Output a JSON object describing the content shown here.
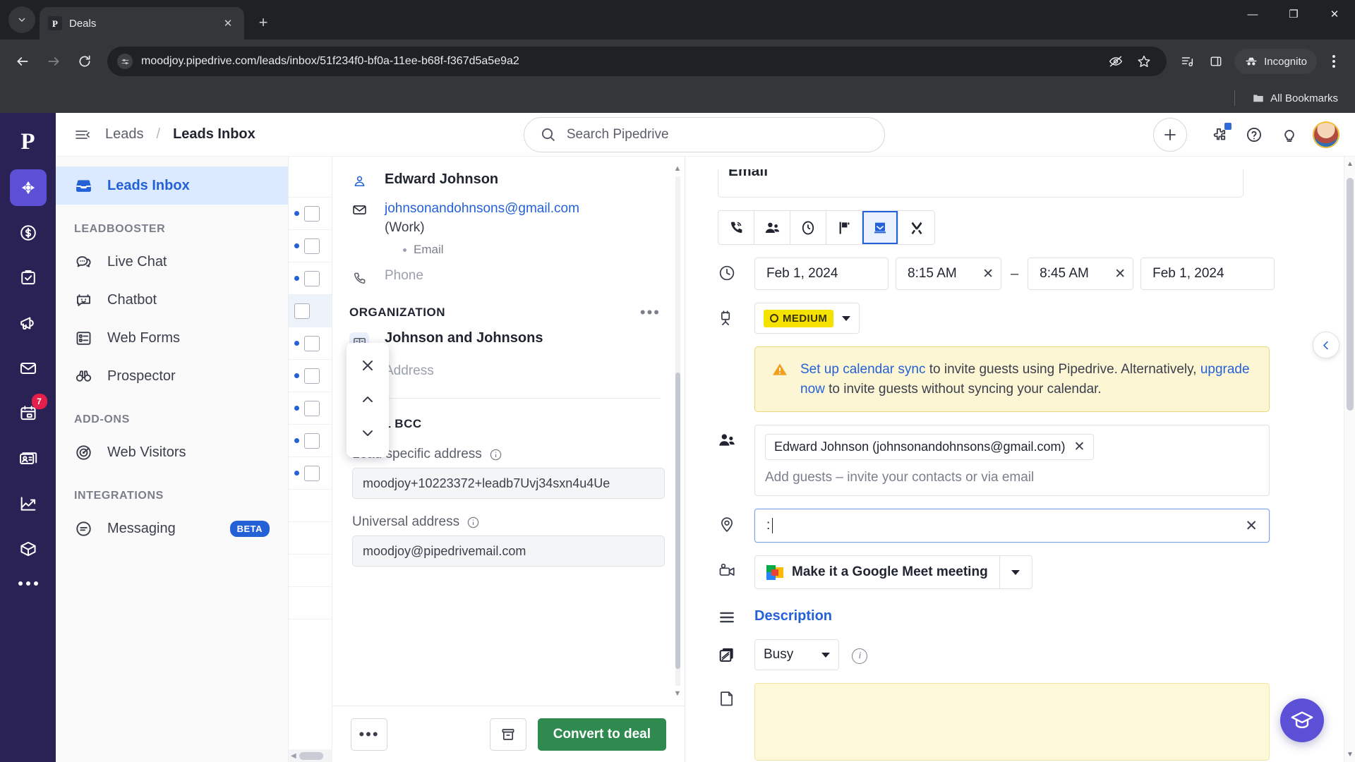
{
  "browser": {
    "tab": {
      "title": "Deals",
      "favicon_letter": "P",
      "favicon_name": "pipedrive-favicon"
    },
    "new_tab_label": "+",
    "url": "moodjoy.pipedrive.com/leads/inbox/51f234f0-bf0a-11ee-b68f-f367d5a5e9a2",
    "incognito_label": "Incognito",
    "bookmarks_label": "All Bookmarks",
    "window": {
      "minimize": "—",
      "maximize": "❐",
      "close": "✕"
    }
  },
  "app": {
    "rail": [
      {
        "name": "pipedrive-logo",
        "label": "P"
      },
      {
        "name": "leads",
        "label": "Leads",
        "active": true
      },
      {
        "name": "deals",
        "label": "Deals"
      },
      {
        "name": "activities",
        "label": "Activities"
      },
      {
        "name": "campaigns",
        "label": "Campaigns"
      },
      {
        "name": "mail",
        "label": "Mail"
      },
      {
        "name": "calendar",
        "label": "Calendar",
        "badge": "7"
      },
      {
        "name": "contacts",
        "label": "Contacts"
      },
      {
        "name": "insights",
        "label": "Insights"
      },
      {
        "name": "products",
        "label": "Products"
      },
      {
        "name": "more",
        "label": "More"
      }
    ],
    "header": {
      "breadcrumb_parent": "Leads",
      "breadcrumb_sep": "/",
      "breadcrumb_current": "Leads Inbox",
      "search_placeholder": "Search Pipedrive",
      "search_value": "",
      "add_label": "+"
    },
    "sidebar": {
      "primary": {
        "label": "Leads Inbox",
        "icon": "inbox-icon"
      },
      "groups": [
        {
          "title": "LEADBOOSTER",
          "items": [
            {
              "label": "Live Chat",
              "icon": "chat-icon"
            },
            {
              "label": "Chatbot",
              "icon": "robot-icon"
            },
            {
              "label": "Web Forms",
              "icon": "form-icon"
            },
            {
              "label": "Prospector",
              "icon": "binoculars-icon"
            }
          ]
        },
        {
          "title": "ADD-ONS",
          "items": [
            {
              "label": "Web Visitors",
              "icon": "radar-icon"
            }
          ]
        },
        {
          "title": "INTEGRATIONS",
          "items": [
            {
              "label": "Messaging",
              "icon": "message-icon",
              "badge": "BETA"
            }
          ]
        }
      ]
    },
    "lead_detail": {
      "person_name": "Edward Johnson",
      "email": "johnsonandohnsons@gmail.com",
      "email_type": "(Work)",
      "email_tag": "Email",
      "phone_placeholder": "Phone",
      "organization_title": "ORGANIZATION",
      "organization_more": "•••",
      "organization_name": "Johnson and Johnsons",
      "address_placeholder": "Address",
      "email_bcc_title": "EMAIL BCC",
      "lead_specific_label": "Lead specific address",
      "lead_specific_value": "moodjoy+10223372+leadb7Uvj34sxn4u4Uе",
      "universal_label": "Universal address",
      "universal_value": "moodjoy@pipedrivemail.com",
      "footer": {
        "more_label": "•••",
        "archive_name": "archive-icon",
        "convert_label": "Convert to deal"
      }
    },
    "activity_form": {
      "subject_value": "Email",
      "types": [
        {
          "name": "call",
          "label": "Call",
          "active": false
        },
        {
          "name": "meeting",
          "label": "Meeting",
          "active": false
        },
        {
          "name": "task",
          "label": "Task",
          "active": false
        },
        {
          "name": "deadline",
          "label": "Deadline",
          "active": false
        },
        {
          "name": "email",
          "label": "Email",
          "active": true
        },
        {
          "name": "lunch",
          "label": "Lunch",
          "active": false
        }
      ],
      "start_date": "Feb 1, 2024",
      "start_time": "8:15 AM",
      "end_time": "8:45 AM",
      "end_date": "Feb 1, 2024",
      "time_separator": "–",
      "clear_label": "✕",
      "priority": "MEDIUM",
      "warning": {
        "link1": "Set up calendar sync",
        "text1": " to invite guests using Pipedrive. Alternatively, ",
        "link2": "upgrade now",
        "text2": " to invite guests without syncing your calendar."
      },
      "guest_chip": "Edward Johnson (johnsonandohnsons@gmail.com)",
      "guest_chip_remove": "✕",
      "guest_placeholder": "Add guests – invite your contacts or via email",
      "location_value": ":",
      "location_clear": "✕",
      "meet_label": "Make it a Google Meet meeting",
      "description_label": "Description",
      "busy_value": "Busy",
      "colors": {
        "accent": "#2461d6",
        "priority_bg": "#f5e200",
        "warning_bg": "#fdf6d5",
        "convert_green": "#2e8a4f",
        "rail_bg": "#2a2254"
      }
    }
  }
}
